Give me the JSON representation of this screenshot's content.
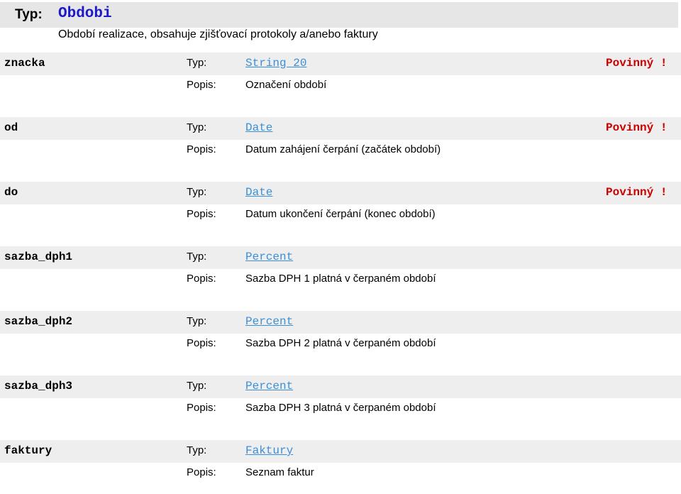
{
  "header": {
    "typ_label": "Typ:",
    "type_name": "Obdobi",
    "description": "Období realizace, obsahuje zjišťovací protokoly a/anebo faktury"
  },
  "labels": {
    "typ": "Typ:",
    "popis": "Popis:"
  },
  "fields": [
    {
      "name": "znacka",
      "type": "String 20",
      "required": "Povinný !",
      "description": "Označení období"
    },
    {
      "name": "od",
      "type": "Date",
      "required": "Povinný !",
      "description": "Datum zahájení čerpání (začátek období)"
    },
    {
      "name": "do",
      "type": "Date",
      "required": "Povinný !",
      "description": "Datum ukončení čerpání (konec období)"
    },
    {
      "name": "sazba_dph1",
      "type": "Percent",
      "required": "",
      "description": "Sazba DPH 1 platná v čerpaném období"
    },
    {
      "name": "sazba_dph2",
      "type": "Percent",
      "required": "",
      "description": "Sazba DPH 2 platná v čerpaném období"
    },
    {
      "name": "sazba_dph3",
      "type": "Percent",
      "required": "",
      "description": "Sazba DPH 3 platná v čerpaném období"
    },
    {
      "name": "faktury",
      "type": "Faktury",
      "required": "",
      "description": "Seznam faktur"
    }
  ],
  "colors": {
    "type_name": "#1a1acc",
    "link": "#3a8fd8",
    "required": "#cc0000",
    "row_bg": "#eeeeee"
  }
}
